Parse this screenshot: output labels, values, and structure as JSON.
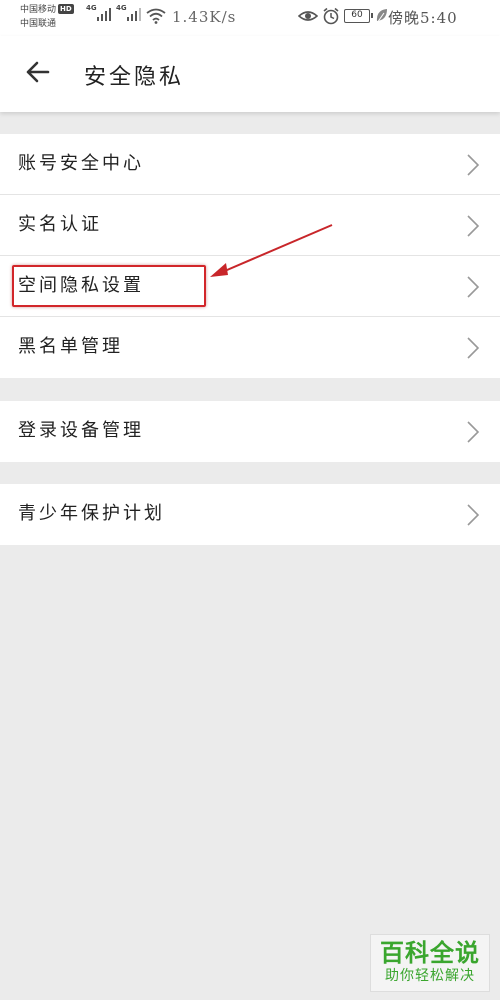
{
  "status_bar": {
    "carrier_1": "中国移动",
    "hd_badge": "HD",
    "carrier_2": "中国联通",
    "network_1": "4G",
    "network_2": "4G",
    "net_speed": "1.43K/s",
    "battery_level": "60",
    "time": "傍晚5:40",
    "icons": [
      "eye-icon",
      "alarm-icon",
      "battery-icon",
      "leaf-icon",
      "wifi-icon",
      "signal-icon"
    ]
  },
  "header": {
    "title": "安全隐私",
    "back_icon": "arrow-left-icon"
  },
  "groups": [
    {
      "items": [
        {
          "label": "账号安全中心",
          "icon": "chevron-right-icon"
        },
        {
          "label": "实名认证",
          "icon": "chevron-right-icon"
        },
        {
          "label": "空间隐私设置",
          "icon": "chevron-right-icon",
          "highlighted": true
        },
        {
          "label": "黑名单管理",
          "icon": "chevron-right-icon"
        }
      ]
    },
    {
      "items": [
        {
          "label": "登录设备管理",
          "icon": "chevron-right-icon"
        }
      ]
    },
    {
      "items": [
        {
          "label": "青少年保护计划",
          "icon": "chevron-right-icon"
        }
      ]
    }
  ],
  "annotation": {
    "color": "#d2262a"
  },
  "watermark": {
    "title": "百科全说",
    "subtitle": "助你轻松解决",
    "color": "#3aa62e"
  }
}
